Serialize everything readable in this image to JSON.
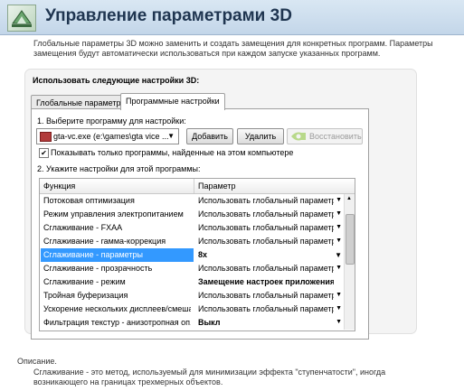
{
  "header": {
    "title": "Управление параметрами 3D",
    "icon": "nvidia-3d-settings-icon"
  },
  "intro_text": "Глобальные параметры 3D можно заменить и создать замещения для конкретных программ. Параметры замещения будут автоматически использоваться при каждом запуске указанных программ.",
  "panel": {
    "heading": "Использовать следующие настройки 3D:",
    "tabs": [
      {
        "label": "Глобальные параметры",
        "active": false
      },
      {
        "label": "Программные настройки",
        "active": true
      }
    ],
    "step1_label": "1. Выберите программу для настройки:",
    "program_select": {
      "value": "gta-vc.exe (e:\\games\\gta vice ..."
    },
    "buttons": {
      "add": "Добавить",
      "remove": "Удалить",
      "restore": "Восстановить"
    },
    "checkbox": {
      "label": "Показывать только программы, найденные на этом компьютере",
      "checked": true
    },
    "step2_label": "2. Укажите настройки для этой программы:",
    "table": {
      "columns": [
        "Функция",
        "Параметр"
      ],
      "rows": [
        {
          "function": "Потоковая оптимизация",
          "value": "Использовать глобальный параметр (А..."
        },
        {
          "function": "Режим управления электропитанием",
          "value": "Использовать глобальный параметр (П..."
        },
        {
          "function": "Сглаживание - FXAA",
          "value": "Использовать глобальный параметр (В..."
        },
        {
          "function": "Сглаживание - гамма-коррекция",
          "value": "Использовать глобальный параметр (Вкл)"
        },
        {
          "function": "Сглаживание - параметры",
          "value": "8x"
        },
        {
          "function": "Сглаживание - прозрачность",
          "value": "Использовать глобальный параметр (В..."
        },
        {
          "function": "Сглаживание - режим",
          "value": "Замещение настроек приложения"
        },
        {
          "function": "Тройная буферизация",
          "value": "Использовать глобальный параметр (В..."
        },
        {
          "function": "Ускорение нескольких дисплеев/смеша...",
          "value": "Использовать глобальный параметр (Р..."
        },
        {
          "function": "Фильтрация текстур - анизотропная оп...",
          "value": "Выкл"
        }
      ]
    }
  },
  "description": {
    "title": "Описание.",
    "text": "Сглаживание - это метод, используемый для минимизации эффекта \"ступенчатости\", иногда возникающего на границах трехмерных объектов."
  },
  "colors": {
    "header_bg": "#c8dbee",
    "selection": "#3399ff",
    "nvidia_green": "#76b900"
  }
}
